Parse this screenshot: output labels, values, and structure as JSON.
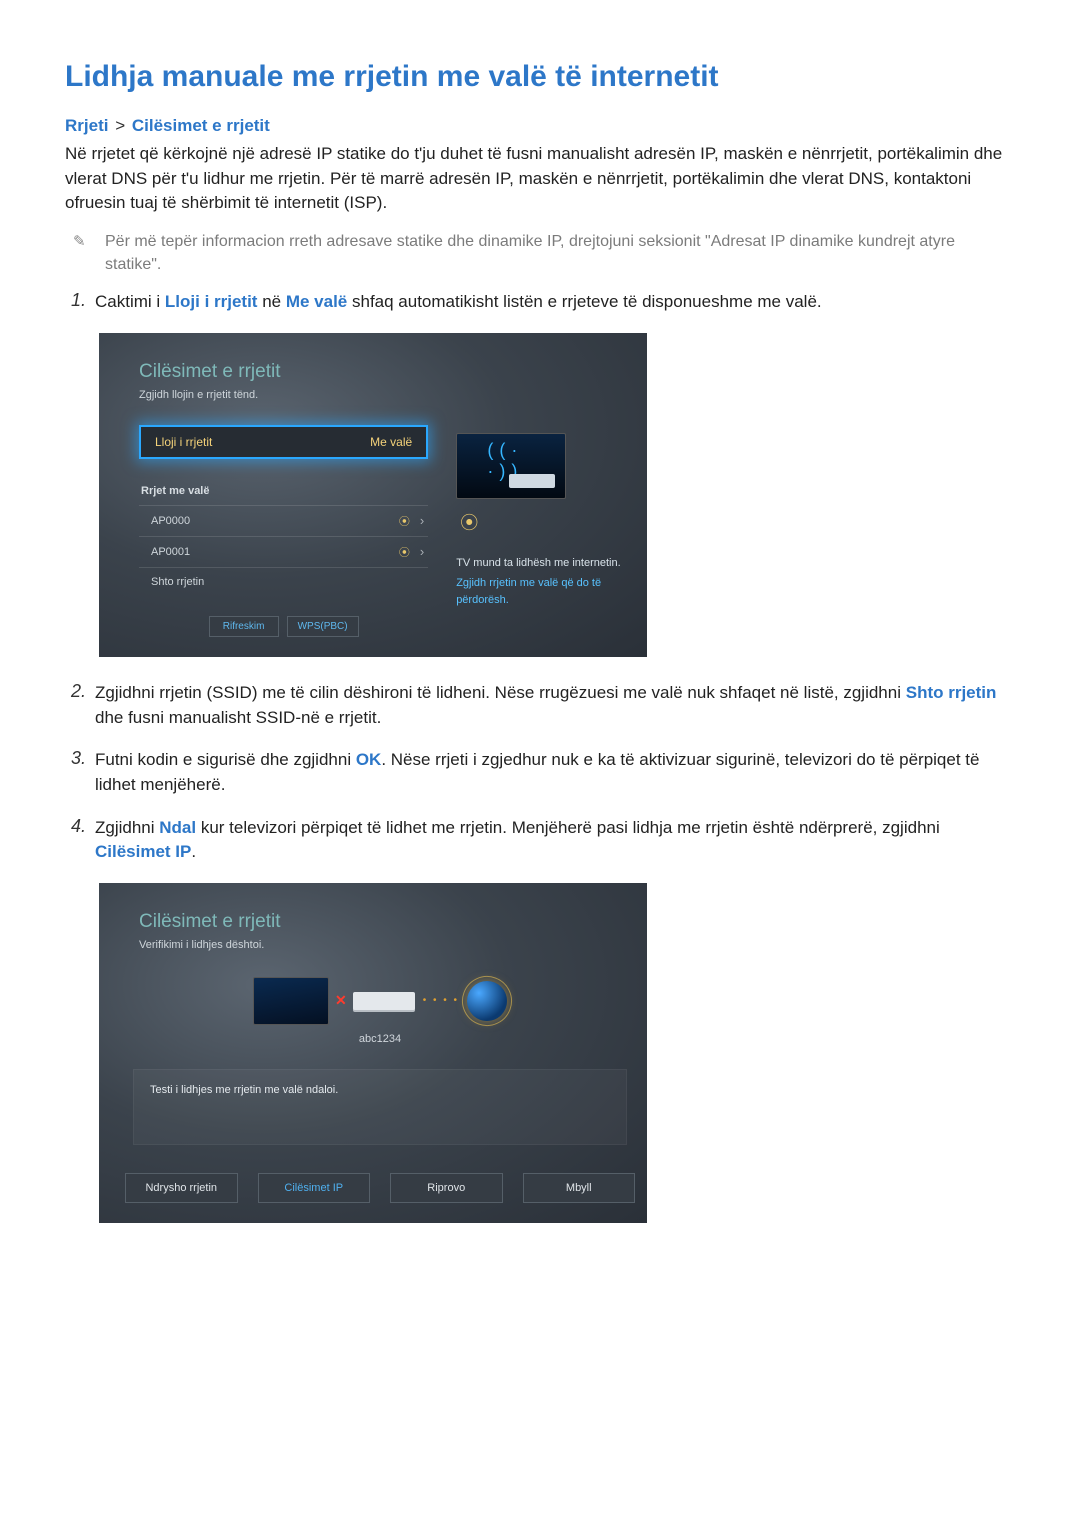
{
  "title": "Lidhja manuale me rrjetin me valë të internetit",
  "breadcrumb": {
    "a": "Rrjeti",
    "b": "Cilësimet e rrjetit"
  },
  "intro": "Në rrjetet që kërkojnë një adresë IP statike do t'ju duhet të fusni manualisht adresën IP, maskën e nënrrjetit, portëkalimin dhe vlerat DNS për t'u lidhur me rrjetin. Për të marrë adresën IP, maskën e nënrrjetit, portëkalimin dhe vlerat DNS, kontaktoni ofruesin tuaj të shërbimit të internetit (ISP).",
  "note": "Për më tepër informacion rreth adresave statike dhe dinamike IP, drejtojuni seksionit \"Adresat IP dinamike kundrejt atyre statike\".",
  "step1": {
    "pre": "Caktimi i ",
    "kw1": "Lloji i rrjetit",
    "mid": " në ",
    "kw2": "Me valë",
    "post": " shfaq automatikisht listën e rrjeteve të disponueshme me valë."
  },
  "panel1": {
    "title": "Cilësimet e rrjetit",
    "sub": "Zgjidh llojin e rrjetit tënd.",
    "row_label": "Lloji i rrjetit",
    "row_value": "Me valë",
    "list_header": "Rrjet me valë",
    "items": [
      "AP0000",
      "AP0001"
    ],
    "add": "Shto rrjetin",
    "btn_refresh": "Rifreskim",
    "btn_wps": "WPS(PBC)",
    "cap1": "TV mund ta lidhësh me internetin.",
    "cap2": "Zgjidh rrjetin me valë që do të përdorësh."
  },
  "step2": {
    "pre": "Zgjidhni rrjetin (SSID) me të cilin dëshironi të lidheni. Nëse rrugëzuesi me valë nuk shfaqet në listë, zgjidhni ",
    "kw": "Shto rrjetin",
    "post": " dhe fusni manualisht SSID-në e rrjetit."
  },
  "step3": {
    "pre": "Futni kodin e sigurisë dhe zgjidhni ",
    "kw": "OK",
    "post": ". Nëse rrjeti i zgjedhur nuk e ka të aktivizuar sigurinë, televizori do të përpiqet të lidhet menjëherë."
  },
  "step4": {
    "pre": "Zgjidhni ",
    "kw1": "Ndal",
    "mid": " kur televizori përpiqet të lidhet me rrjetin. Menjëherë pasi lidhja me rrjetin është ndërprerë, zgjidhni ",
    "kw2": "Cilësimet IP",
    "post": "."
  },
  "panel2": {
    "title": "Cilësimet e rrjetit",
    "sub": "Verifikimi i lidhjes dështoi.",
    "router_label": "abc1234",
    "msg": "Testi i lidhjes me rrjetin me valë ndaloi.",
    "btns": [
      "Ndrysho rrjetin",
      "Cilësimet IP",
      "Riprovo",
      "Mbyll"
    ]
  }
}
